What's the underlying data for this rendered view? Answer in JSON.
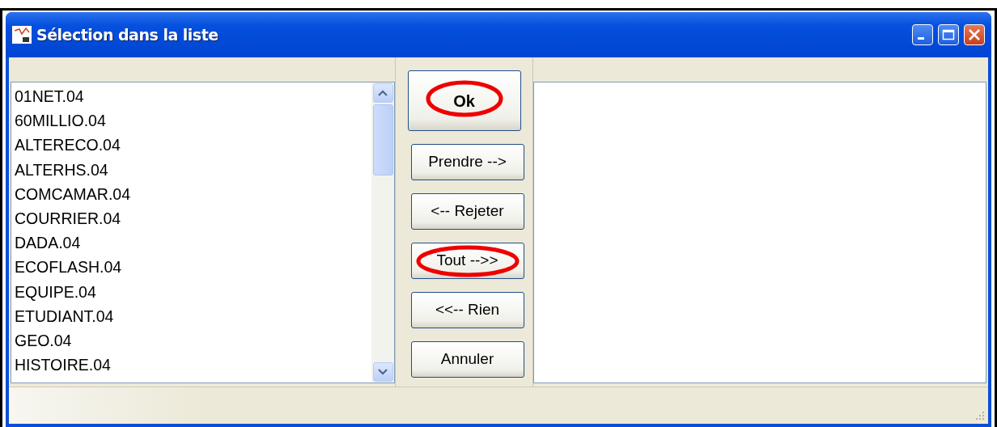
{
  "window": {
    "title": "Sélection dans la liste"
  },
  "source_list": {
    "items": [
      "01NET.04",
      "60MILLIO.04",
      "ALTERECO.04",
      "ALTERHS.04",
      "COMCAMAR.04",
      "COURRIER.04",
      "DADA.04",
      "ECOFLASH.04",
      "EQUIPE.04",
      "ETUDIANT.04",
      "GEO.04",
      "HISTOIRE.04"
    ]
  },
  "buttons": [
    {
      "label": "Ok",
      "kind": "default",
      "circled": true
    },
    {
      "label": "Prendre -->",
      "kind": "normal",
      "circled": false
    },
    {
      "label": "<-- Rejeter",
      "kind": "normal",
      "circled": false
    },
    {
      "label": "Tout -->>",
      "kind": "normal",
      "circled": true
    },
    {
      "label": "<<-- Rien",
      "kind": "normal",
      "circled": false
    },
    {
      "label": "Annuler",
      "kind": "normal",
      "circled": false
    }
  ]
}
